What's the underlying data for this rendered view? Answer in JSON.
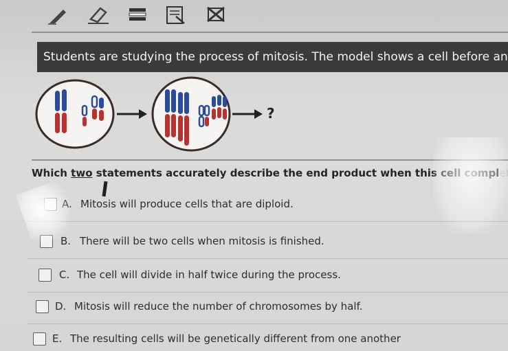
{
  "toolbar": {
    "tools": [
      "pencil-icon",
      "eraser-icon",
      "line-reader-icon",
      "notepad-icon",
      "eliminate-choice-icon"
    ]
  },
  "prompt": {
    "text": "Students are studying the process of mitosis. The model shows a cell before and af"
  },
  "model": {
    "result_label": "?",
    "colors": {
      "red": "#b8322f",
      "blue": "#2a4c9b",
      "cell_outline": "#3a2a2a"
    }
  },
  "question": {
    "before": "Which ",
    "emphasis": "two",
    "middle": " statements accurately describe the end product when this cell compl",
    "faded": "etes mitosis"
  },
  "choices": [
    {
      "letter": "A.",
      "text": "Mitosis will produce cells that are diploid."
    },
    {
      "letter": "B.",
      "text": "There will be two cells when mitosis is finished."
    },
    {
      "letter": "C.",
      "text": "The cell will divide in half twice during the process."
    },
    {
      "letter": "D.",
      "text": "Mitosis will reduce the number of chromosomes by half."
    },
    {
      "letter": "E.",
      "text": "The resulting cells will be genetically different from one another"
    }
  ]
}
